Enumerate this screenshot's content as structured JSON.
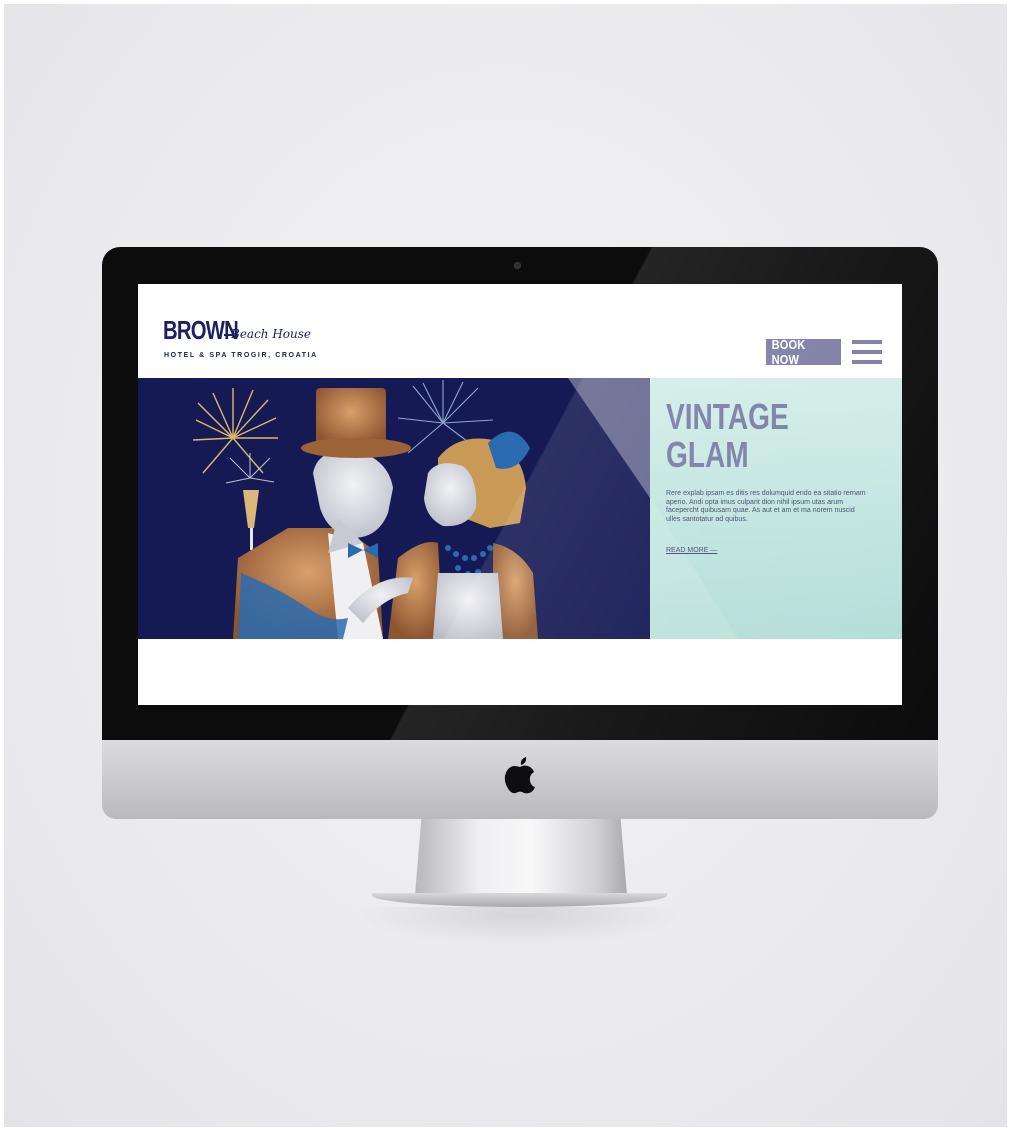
{
  "header": {
    "logo_main": "BROWN",
    "logo_script": "Beach House",
    "logo_tagline": "HOTEL & SPA TROGIR, CROATIA",
    "book_button_label": "BOOK NOW"
  },
  "hero": {
    "title_line1": "VINTAGE",
    "title_line2": "GLAM",
    "body": "Rere explab ipsam es ditis res dolumquid endo ea sitatio rernam aperio. Andi opta imus culparit dion nihil ipsum utas arum facepercht quibusam quae. As aut et am et ma norem nuscid ulles santotatur ad quibus.",
    "read_more_label": "READ MORE —"
  },
  "colors": {
    "brand_navy": "#1c1f60",
    "accent_lavender": "#7e7ea6",
    "panel_mint": "#c4e7e1",
    "hero_navy": "#151a55"
  },
  "icons": {
    "menu": "hamburger-icon",
    "apple": "apple-logo-icon"
  }
}
